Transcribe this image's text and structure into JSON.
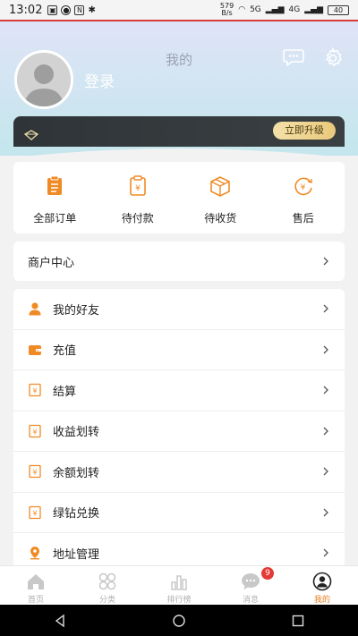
{
  "statusbar": {
    "time": "13:02",
    "speed_top": "579",
    "speed_bottom": "B/s",
    "signal1": "5G",
    "signal2": "4G",
    "battery": "40"
  },
  "header": {
    "title": "我的",
    "login_label": "登录",
    "upgrade_label": "立即升级"
  },
  "orders": [
    {
      "label": "全部订单",
      "icon": "clipboard-icon"
    },
    {
      "label": "待付款",
      "icon": "yen-clipboard-icon"
    },
    {
      "label": "待收货",
      "icon": "package-icon"
    },
    {
      "label": "售后",
      "icon": "yen-refresh-icon"
    }
  ],
  "merchant": {
    "label": "商户中心"
  },
  "menu": [
    {
      "label": "我的好友",
      "icon": "person-icon"
    },
    {
      "label": "充值",
      "icon": "wallet-icon"
    },
    {
      "label": "结算",
      "icon": "yen-doc-icon"
    },
    {
      "label": "收益划转",
      "icon": "yen-doc-icon"
    },
    {
      "label": "余额划转",
      "icon": "yen-doc-icon"
    },
    {
      "label": "绿钻兑换",
      "icon": "yen-doc-icon"
    },
    {
      "label": "地址管理",
      "icon": "location-icon"
    }
  ],
  "tabs": [
    {
      "label": "首页",
      "icon": "home-icon"
    },
    {
      "label": "分类",
      "icon": "grid-icon"
    },
    {
      "label": "排行榜",
      "icon": "chart-icon"
    },
    {
      "label": "消息",
      "icon": "chat-icon",
      "badge": "9"
    },
    {
      "label": "我的",
      "icon": "user-circle-icon"
    }
  ],
  "colors": {
    "accent": "#e67e22",
    "vip_dark": "#2f3438",
    "badge": "#e53935"
  }
}
